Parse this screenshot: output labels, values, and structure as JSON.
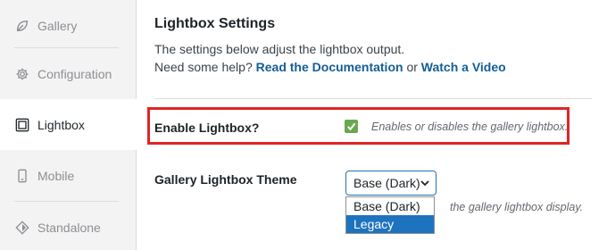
{
  "sidebar": {
    "items": [
      {
        "label": "Gallery",
        "icon": "leaf-icon"
      },
      {
        "label": "Configuration",
        "icon": "gear-icon"
      },
      {
        "label": "Lightbox",
        "icon": "lightbox-icon"
      },
      {
        "label": "Mobile",
        "icon": "mobile-icon"
      },
      {
        "label": "Standalone",
        "icon": "diamond-icon"
      }
    ],
    "active": "Lightbox"
  },
  "main": {
    "title": "Lightbox Settings",
    "description_line1": "The settings below adjust the lightbox output.",
    "description_line2_prefix": "Need some help?",
    "doc_link": "Read the Documentation",
    "or_text": "or",
    "video_link": "Watch a Video"
  },
  "settings": {
    "enable_lightbox": {
      "label": "Enable Lightbox?",
      "checked": true,
      "hint": "Enables or disables the gallery lightbox."
    },
    "theme": {
      "label": "Gallery Lightbox Theme",
      "selected": "Base (Dark)",
      "options": [
        "Base (Dark)",
        "Legacy"
      ],
      "highlighted_option": "Legacy",
      "hint_partial": "the gallery lightbox display."
    }
  },
  "colors": {
    "accent": "#2271b1",
    "highlight_border": "#e02424",
    "checkbox": "#6aa84f",
    "selected_option": "#1e73be",
    "link": "#135e96"
  }
}
